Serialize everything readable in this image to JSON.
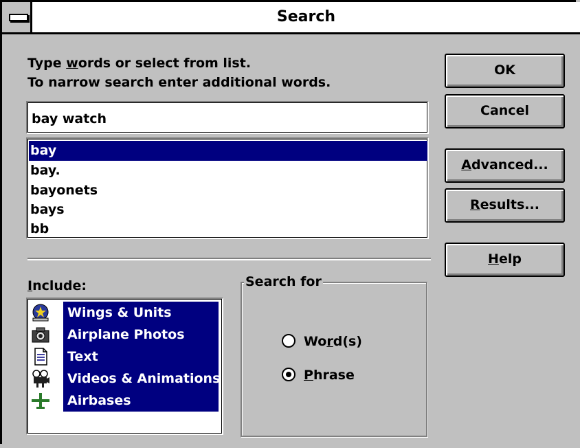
{
  "window": {
    "title": "Search"
  },
  "instructions": {
    "line1_pre": "Type ",
    "line1_accel": "w",
    "line1_post": "ords or select from list.",
    "line2": "To narrow search enter additional words."
  },
  "search": {
    "value": "bay watch"
  },
  "word_list": {
    "items": [
      "bay",
      "bay.",
      "bayonets",
      "bays",
      "bb"
    ],
    "selected": "bay"
  },
  "buttons": {
    "ok": "OK",
    "cancel": "Cancel",
    "advanced_accel": "A",
    "advanced_rest": "dvanced...",
    "results_accel": "R",
    "results_rest": "esults...",
    "help_accel": "H",
    "help_rest": "elp"
  },
  "include": {
    "label_accel": "I",
    "label_rest": "nclude:",
    "items": [
      {
        "label": "Wings & Units",
        "icon": "insignia-icon"
      },
      {
        "label": "Airplane Photos",
        "icon": "camera-icon"
      },
      {
        "label": "Text",
        "icon": "document-icon"
      },
      {
        "label": "Videos & Animations",
        "icon": "film-camera-icon"
      },
      {
        "label": "Airbases",
        "icon": "airplane-icon"
      }
    ]
  },
  "search_for": {
    "title": "Search for",
    "word_pre": "Wo",
    "word_accel": "r",
    "word_post": "d(s)",
    "phrase_accel": "P",
    "phrase_rest": "hrase",
    "selected": "Phrase"
  },
  "colors": {
    "face": "#c0c0c0",
    "highlight": "#000080"
  }
}
